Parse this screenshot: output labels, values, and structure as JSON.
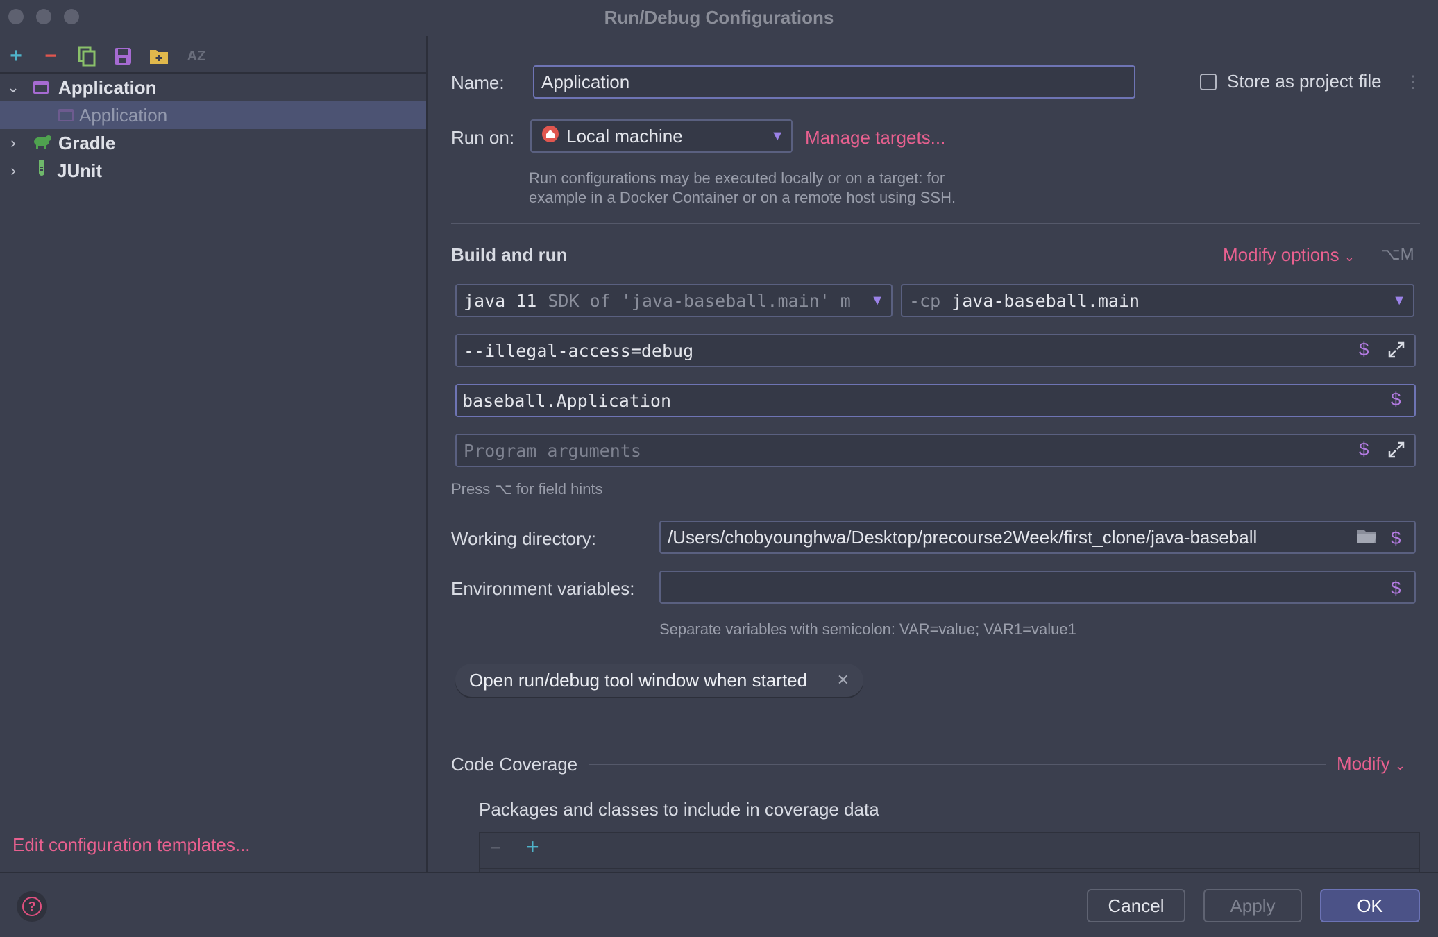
{
  "window": {
    "title": "Run/Debug Configurations"
  },
  "toolbar": {
    "icons": [
      "plus-icon",
      "minus-icon",
      "copy-icon",
      "save-icon",
      "folder-add-icon",
      "sort-az-icon"
    ],
    "sort_label": "AZ"
  },
  "tree": {
    "items": [
      {
        "label": "Application",
        "expanded": true,
        "icon": "application-icon"
      },
      {
        "label": "Application",
        "selected": true,
        "icon": "application-icon"
      },
      {
        "label": "Gradle",
        "expanded": false,
        "icon": "gradle-icon"
      },
      {
        "label": "JUnit",
        "expanded": false,
        "icon": "junit-icon"
      }
    ]
  },
  "left_footer": {
    "edit_templates": "Edit configuration templates..."
  },
  "form": {
    "name_label": "Name:",
    "name_value": "Application",
    "store_label": "Store as project file",
    "store_checked": false,
    "run_on_label": "Run on:",
    "run_on_value": "Local machine",
    "manage_targets": "Manage targets...",
    "run_on_hint_1": "Run configurations may be executed locally or on a target: for",
    "run_on_hint_2": "example in a Docker Container or on a remote host using SSH."
  },
  "build_run": {
    "title": "Build and run",
    "modify_options": "Modify options",
    "modify_shortcut": "⌥M",
    "jdk_main": "java 11",
    "jdk_detail": "SDK of 'java-baseball.main' m",
    "cp_prefix": "-cp",
    "cp_value": "java-baseball.main",
    "vm_options": "--illegal-access=debug",
    "main_class": "baseball.Application",
    "program_args_placeholder": "Program arguments",
    "field_hint": "Press ⌥ for field hints",
    "working_dir_label": "Working directory:",
    "working_dir_value": "/Users/chobyounghwa/Desktop/precourse2Week/first_clone/java-baseball",
    "env_label": "Environment variables:",
    "env_value": "",
    "env_hint": "Separate variables with semicolon: VAR=value; VAR1=value1",
    "chip_label": "Open run/debug tool window when started",
    "dollar": "$"
  },
  "coverage": {
    "title": "Code Coverage",
    "modify": "Modify",
    "packages_label": "Packages and classes to include in coverage data"
  },
  "buttons": {
    "cancel": "Cancel",
    "apply": "Apply",
    "ok": "OK"
  },
  "colors": {
    "accent_link": "#e8608f",
    "dollar": "#b27ae0",
    "selection": "#4c5373",
    "primary": "#4b5287"
  }
}
